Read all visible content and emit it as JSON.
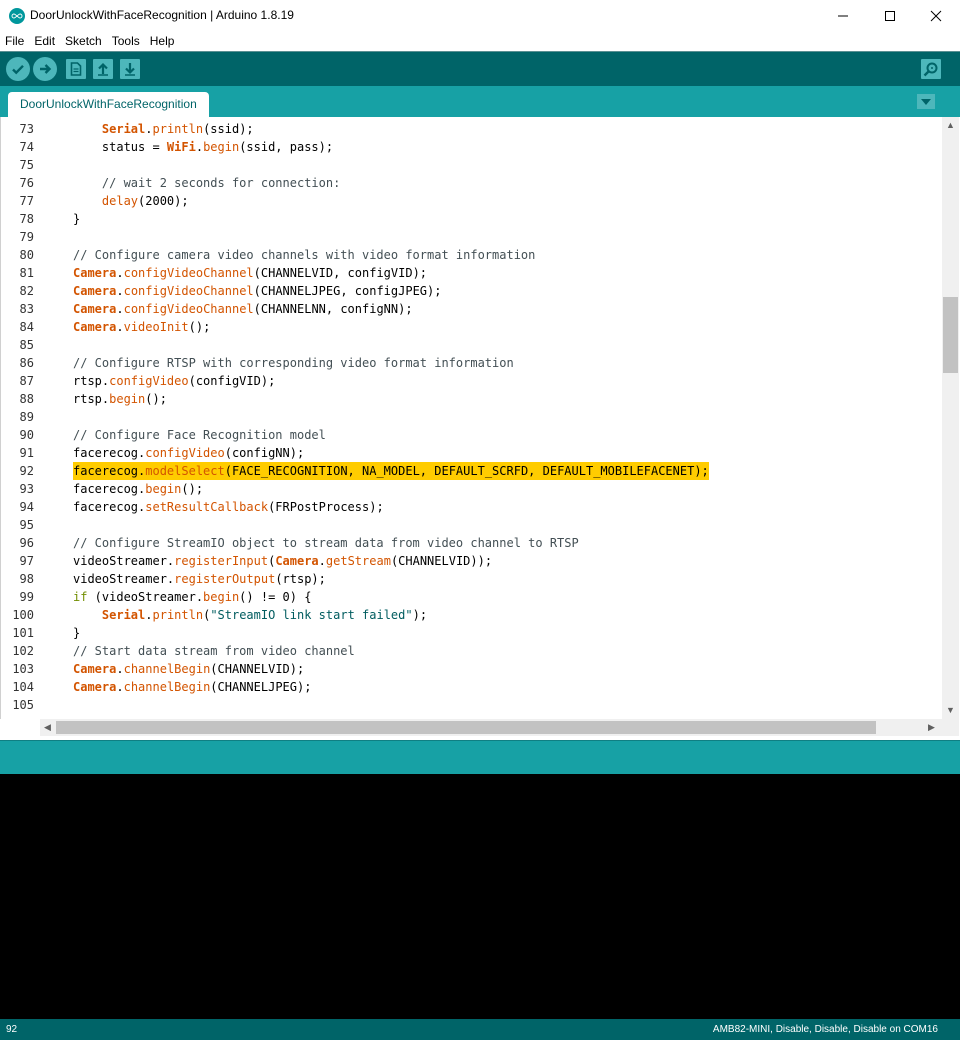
{
  "window": {
    "title": "DoorUnlockWithFaceRecognition | Arduino 1.8.19",
    "icon": "arduino-logo-icon"
  },
  "menu": [
    "File",
    "Edit",
    "Sketch",
    "Tools",
    "Help"
  ],
  "toolbar": {
    "verify": "check-icon",
    "upload": "arrow-right-icon",
    "new": "new-file-icon",
    "open": "arrow-up-icon",
    "save": "arrow-down-icon",
    "serial_monitor": "magnifier-icon"
  },
  "tabs": [
    {
      "label": "DoorUnlockWithFaceRecognition",
      "active": true
    }
  ],
  "editor": {
    "highlighted_line": 92,
    "lines": [
      {
        "n": "73",
        "text": "    Serial.println(ssid);"
      },
      {
        "n": "74",
        "text": "    status = WiFi.begin(ssid, pass);"
      },
      {
        "n": "75",
        "text": ""
      },
      {
        "n": "76",
        "text": "    // wait 2 seconds for connection:"
      },
      {
        "n": "77",
        "text": "    delay(2000);"
      },
      {
        "n": "78",
        "text": "}"
      },
      {
        "n": "79",
        "text": ""
      },
      {
        "n": "80",
        "text": "// Configure camera video channels with video format information"
      },
      {
        "n": "81",
        "text": "Camera.configVideoChannel(CHANNELVID, configVID);"
      },
      {
        "n": "82",
        "text": "Camera.configVideoChannel(CHANNELJPEG, configJPEG);"
      },
      {
        "n": "83",
        "text": "Camera.configVideoChannel(CHANNELNN, configNN);"
      },
      {
        "n": "84",
        "text": "Camera.videoInit();"
      },
      {
        "n": "85",
        "text": ""
      },
      {
        "n": "86",
        "text": "// Configure RTSP with corresponding video format information"
      },
      {
        "n": "87",
        "text": "rtsp.configVideo(configVID);"
      },
      {
        "n": "88",
        "text": "rtsp.begin();"
      },
      {
        "n": "89",
        "text": ""
      },
      {
        "n": "90",
        "text": "// Configure Face Recognition model"
      },
      {
        "n": "91",
        "text": "facerecog.configVideo(configNN);"
      },
      {
        "n": "92",
        "text": "facerecog.modelSelect(FACE_RECOGNITION, NA_MODEL, DEFAULT_SCRFD, DEFAULT_MOBILEFACENET);"
      },
      {
        "n": "93",
        "text": "facerecog.begin();"
      },
      {
        "n": "94",
        "text": "facerecog.setResultCallback(FRPostProcess);"
      },
      {
        "n": "95",
        "text": ""
      },
      {
        "n": "96",
        "text": "// Configure StreamIO object to stream data from video channel to RTSP"
      },
      {
        "n": "97",
        "text": "videoStreamer.registerInput(Camera.getStream(CHANNELVID));"
      },
      {
        "n": "98",
        "text": "videoStreamer.registerOutput(rtsp);"
      },
      {
        "n": "99",
        "text": "if (videoStreamer.begin() != 0) {"
      },
      {
        "n": "100",
        "text": "    Serial.println(\"StreamIO link start failed\");"
      },
      {
        "n": "101",
        "text": "}"
      },
      {
        "n": "102",
        "text": "// Start data stream from video channel"
      },
      {
        "n": "103",
        "text": "Camera.channelBegin(CHANNELVID);"
      },
      {
        "n": "104",
        "text": "Camera.channelBegin(CHANNELJPEG);"
      },
      {
        "n": "105",
        "text": ""
      }
    ]
  },
  "status": {
    "line_number": "92",
    "board": "AMB82-MINI, Disable, Disable, Disable on COM16"
  },
  "colors": {
    "toolbar": "#006468",
    "tabbar": "#17a1a5",
    "button": "#4db7bb",
    "highlight": "#ffcc00",
    "keyword": "#d35400",
    "comment": "#434f54"
  }
}
